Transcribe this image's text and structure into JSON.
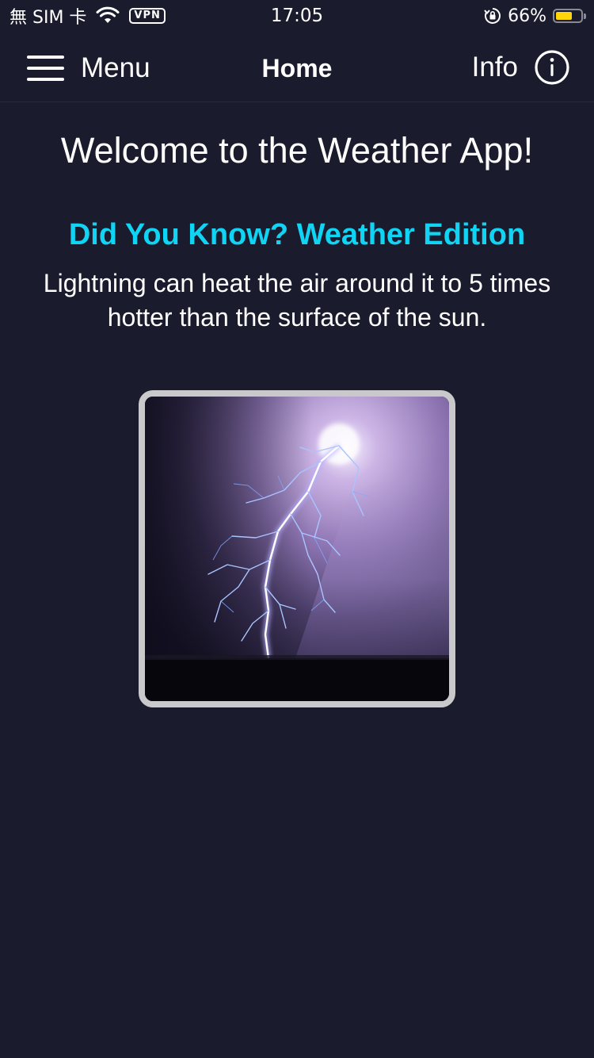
{
  "status_bar": {
    "carrier": "無 SIM 卡",
    "vpn_label": "VPN",
    "time": "17:05",
    "battery_percent": "66%",
    "battery_level": 0.66,
    "battery_color": "#ffd60a"
  },
  "nav": {
    "menu_label": "Menu",
    "menu_icon": "hamburger-icon",
    "title": "Home",
    "info_label": "Info",
    "info_icon": "info-circle-icon"
  },
  "content": {
    "welcome": "Welcome to the Weather App!",
    "fact_heading": "Did You Know? Weather Edition",
    "fact_heading_color": "#10d4f4",
    "fact_text": "Lightning can heat the air around it to 5 times hotter than the surface of the sun.",
    "image_subject": "lightning-strike-photo"
  },
  "colors": {
    "background": "#1b1b2e",
    "frame_border": "#c9c9cc"
  }
}
